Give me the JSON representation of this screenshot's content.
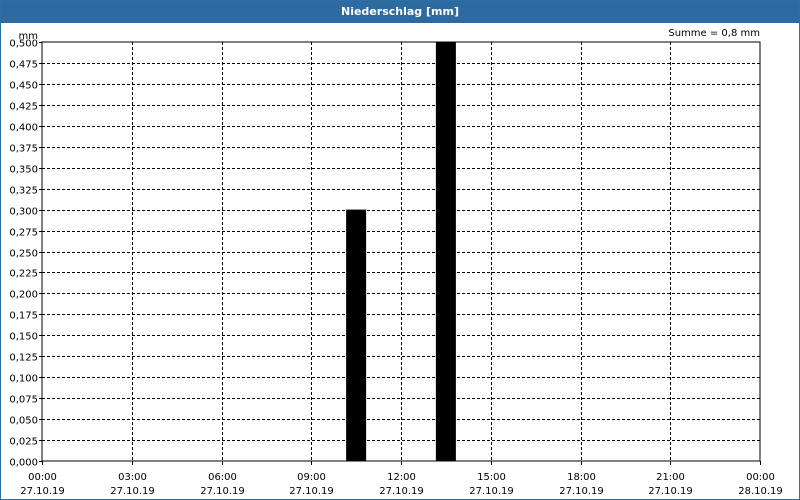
{
  "window": {
    "title": "Niederschlag [mm]",
    "title_bar_color": "#2d6aa0"
  },
  "chart_data": {
    "type": "bar",
    "title": "Niederschlag [mm]",
    "ylabel": "mm",
    "annotation": "Summe = 0,8 mm",
    "ylim": [
      0,
      0.5
    ],
    "y_ticks": [
      "0,000",
      "0,025",
      "0,050",
      "0,075",
      "0,100",
      "0,125",
      "0,150",
      "0,175",
      "0,200",
      "0,225",
      "0,250",
      "0,275",
      "0,300",
      "0,325",
      "0,350",
      "0,375",
      "0,400",
      "0,425",
      "0,450",
      "0,475",
      "0,500"
    ],
    "x_ticks": [
      {
        "time": "00:00",
        "date": "27.10.19"
      },
      {
        "time": "03:00",
        "date": "27.10.19"
      },
      {
        "time": "06:00",
        "date": "27.10.19"
      },
      {
        "time": "09:00",
        "date": "27.10.19"
      },
      {
        "time": "12:00",
        "date": "27.10.19"
      },
      {
        "time": "15:00",
        "date": "27.10.19"
      },
      {
        "time": "18:00",
        "date": "27.10.19"
      },
      {
        "time": "21:00",
        "date": "27.10.19"
      },
      {
        "time": "00:00",
        "date": "28.10.19"
      }
    ],
    "xlim": [
      "27.10.19 00:00",
      "28.10.19 00:00"
    ],
    "bars": [
      {
        "time": "27.10.19 10:30",
        "value": 0.3
      },
      {
        "time": "27.10.19 13:30",
        "value": 0.5
      }
    ],
    "grid": true,
    "bar_color": "#000000"
  }
}
